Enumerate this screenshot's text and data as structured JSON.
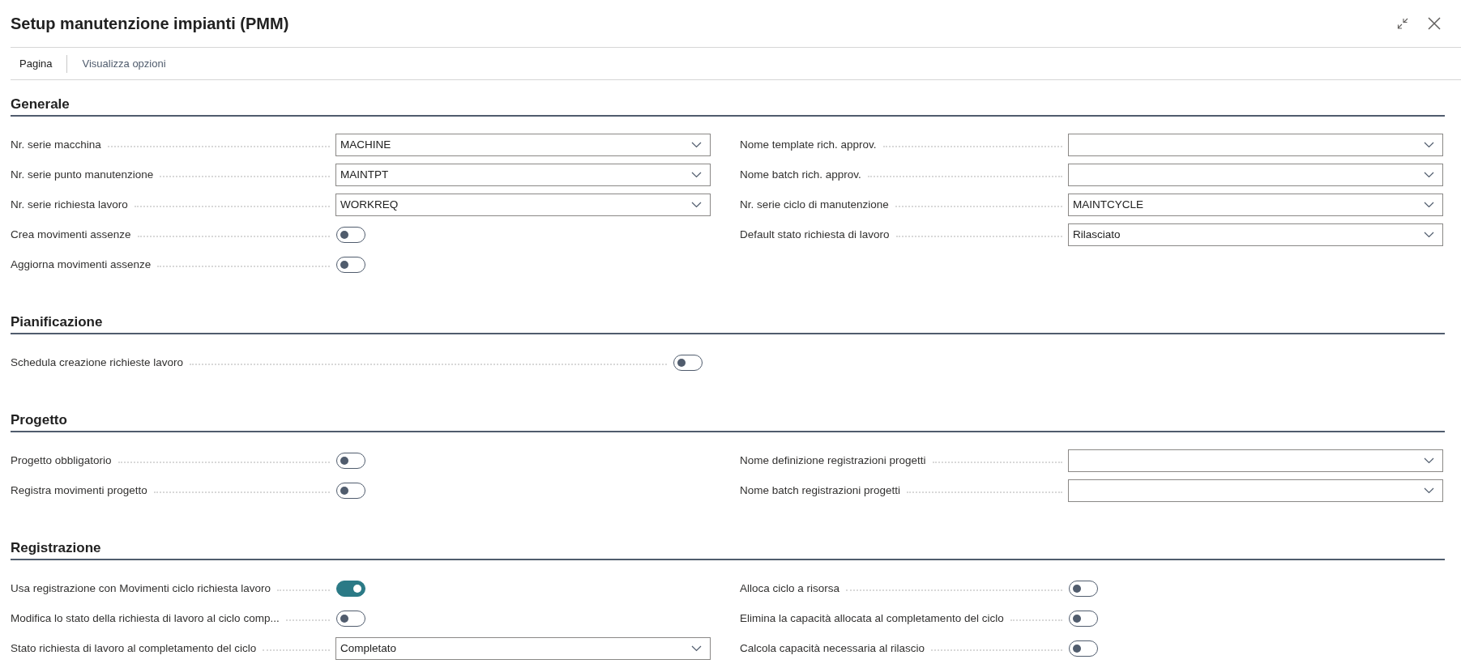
{
  "title": "Setup manutenzione impianti (PMM)",
  "action_bar": [
    {
      "label": "Pagina",
      "selected": true
    },
    {
      "label": "Visualizza opzioni",
      "selected": false
    }
  ],
  "sections": [
    {
      "title": "Generale",
      "columns": [
        [
          {
            "kind": "dropdown",
            "label": "Nr. serie macchina",
            "value": "MACHINE"
          },
          {
            "kind": "dropdown",
            "label": "Nr. serie punto manutenzione",
            "value": "MAINTPT"
          },
          {
            "kind": "dropdown",
            "label": "Nr. serie richiesta lavoro",
            "value": "WORKREQ"
          },
          {
            "kind": "toggle",
            "label": "Crea movimenti assenze",
            "on": false
          },
          {
            "kind": "toggle",
            "label": "Aggiorna movimenti assenze",
            "on": false
          }
        ],
        [
          {
            "kind": "dropdown",
            "label": "Nome template rich. approv."
          },
          {
            "kind": "dropdown",
            "label": "Nome batch rich. approv."
          },
          {
            "kind": "dropdown",
            "label": "Nr. serie ciclo di manutenzione",
            "value": "MAINTCYCLE"
          },
          {
            "kind": "dropdown",
            "label": "Default stato richiesta di lavoro",
            "value": "Rilasciato"
          }
        ]
      ]
    },
    {
      "title": "Pianificazione",
      "columns": [
        [
          {
            "kind": "toggle",
            "label": "Schedula creazione richieste lavoro",
            "on": false
          }
        ]
      ]
    },
    {
      "title": "Progetto",
      "columns": [
        [
          {
            "kind": "toggle",
            "label": "Progetto obbligatorio",
            "on": false
          },
          {
            "kind": "toggle",
            "label": "Registra movimenti progetto",
            "on": false
          }
        ],
        [
          {
            "kind": "dropdown",
            "label": "Nome definizione registrazioni progetti"
          },
          {
            "kind": "dropdown",
            "label": "Nome batch registrazioni progetti"
          }
        ]
      ]
    },
    {
      "title": "Registrazione",
      "columns": [
        [
          {
            "kind": "toggle",
            "label": "Usa registrazione con Movimenti ciclo richiesta lavoro",
            "on": true
          },
          {
            "kind": "toggle",
            "label": "Modifica lo stato della richiesta di lavoro al ciclo comp...",
            "on": false
          },
          {
            "kind": "dropdown",
            "label": "Stato richiesta di lavoro al completamento del ciclo",
            "value": "Completato"
          }
        ],
        [
          {
            "kind": "toggle",
            "label": "Alloca ciclo a risorsa",
            "on": false
          },
          {
            "kind": "toggle",
            "label": "Elimina la capacità allocata al completamento del ciclo",
            "on": false
          },
          {
            "kind": "toggle",
            "label": "Calcola capacità necessaria al rilascio",
            "on": false
          }
        ]
      ]
    }
  ]
}
